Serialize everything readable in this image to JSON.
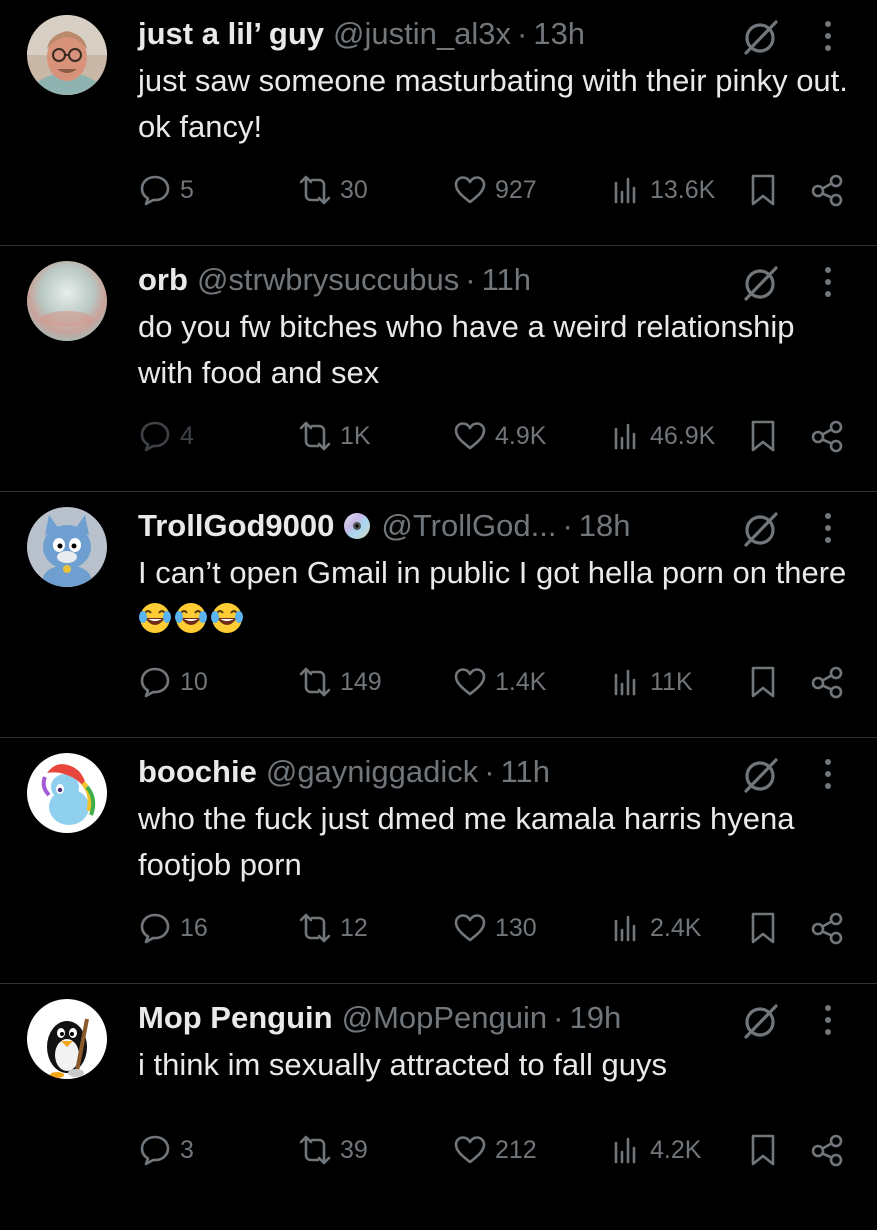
{
  "colors": {
    "background": "#000000",
    "text_primary": "#e7e9ea",
    "text_secondary": "#71767b",
    "divider": "#2f3336"
  },
  "tweets": [
    {
      "name": "just a lil’ guy",
      "handle": "@justin_al3x",
      "dot": "·",
      "time": "13h",
      "text": "just saw someone masturbating with their pinky out. ok fancy!",
      "replies": "5",
      "reposts": "30",
      "likes": "927",
      "views": "13.6K",
      "avatar": "avatar-photo-man-glasses",
      "icons": [
        "grok-icon",
        "more-icon",
        "reply-icon",
        "repost-icon",
        "like-icon",
        "views-icon",
        "bookmark-icon",
        "share-icon"
      ]
    },
    {
      "name": "orb",
      "handle": "@strwbrysuccubus",
      "dot": "·",
      "time": "11h",
      "text": "do you fw bitches who have a weird relationship with food and sex",
      "replies": "4",
      "reposts": "1K",
      "likes": "4.9K",
      "views": "46.9K",
      "avatar": "avatar-pale-orb",
      "icons": [
        "grok-icon",
        "more-icon",
        "reply-icon",
        "repost-icon",
        "like-icon",
        "views-icon",
        "bookmark-icon",
        "share-icon"
      ]
    },
    {
      "name": "TrollGod9000",
      "handle": "@TrollGod...",
      "dot": "·",
      "time": "18h",
      "text": "I can’t open Gmail in public I got hella porn on there",
      "emoji": "😂😂😂",
      "replies": "10",
      "reposts": "149",
      "likes": "1.4K",
      "views": "11K",
      "avatar": "avatar-blue-cat-cartoon",
      "badge": "disc-icon",
      "icons": [
        "grok-icon",
        "more-icon",
        "reply-icon",
        "repost-icon",
        "like-icon",
        "views-icon",
        "bookmark-icon",
        "share-icon"
      ]
    },
    {
      "name": "boochie",
      "handle": "@gayniggadick",
      "dot": "·",
      "time": "11h",
      "text": "who the fuck just dmed me kamala harris hyena footjob porn",
      "replies": "16",
      "reposts": "12",
      "likes": "130",
      "views": "2.4K",
      "avatar": "avatar-rainbow-pony",
      "icons": [
        "grok-icon",
        "more-icon",
        "reply-icon",
        "repost-icon",
        "like-icon",
        "views-icon",
        "bookmark-icon",
        "share-icon"
      ]
    },
    {
      "name": "Mop Penguin",
      "handle": "@MopPenguin",
      "dot": "·",
      "time": "19h",
      "text": "i think im sexually attracted to fall guys",
      "replies": "3",
      "reposts": "39",
      "likes": "212",
      "views": "4.2K",
      "avatar": "avatar-black-penguin",
      "icons": [
        "grok-icon",
        "more-icon",
        "reply-icon",
        "repost-icon",
        "like-icon",
        "views-icon",
        "bookmark-icon",
        "share-icon"
      ]
    }
  ]
}
